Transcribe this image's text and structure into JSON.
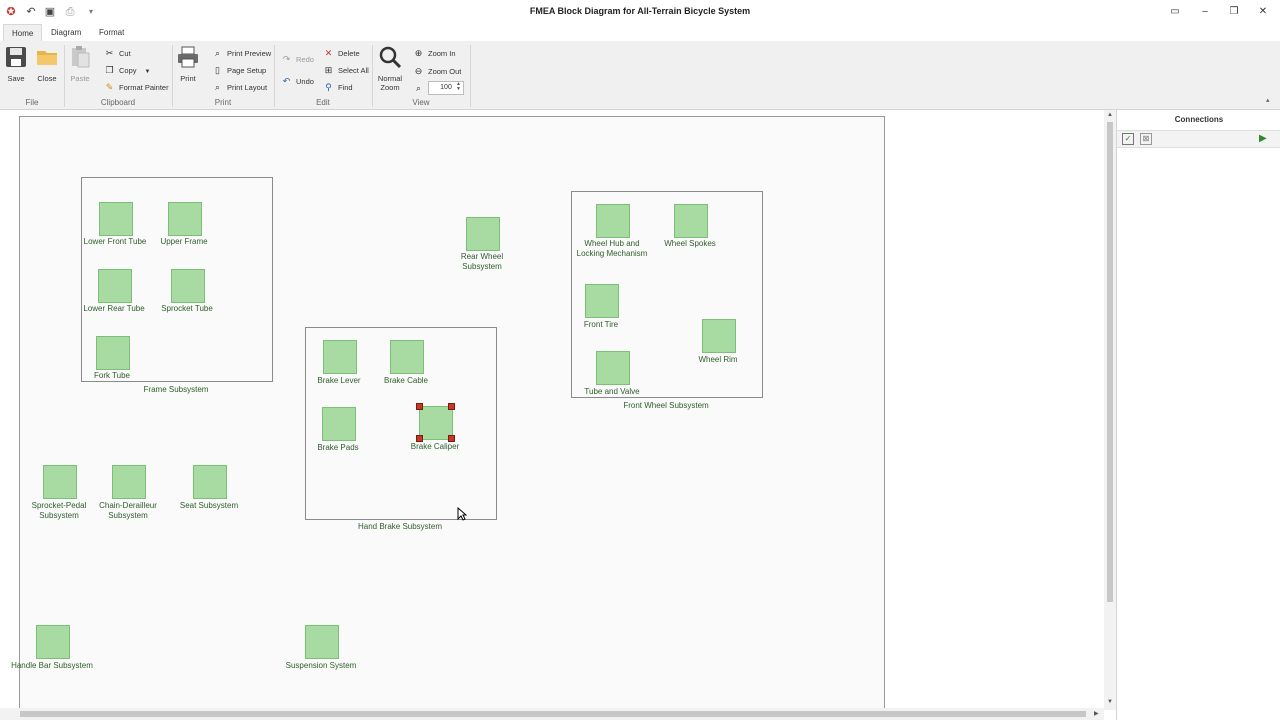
{
  "window": {
    "title": "FMEA Block Diagram for All-Terrain Bicycle System"
  },
  "tabs": [
    "Home",
    "Diagram",
    "Format"
  ],
  "ribbon": {
    "file": {
      "label": "File",
      "save": "Save",
      "close": "Close"
    },
    "clipboard": {
      "label": "Clipboard",
      "paste": "Paste",
      "cut": "Cut",
      "copy": "Copy",
      "format_painter": "Format Painter"
    },
    "print": {
      "label": "Print",
      "print": "Print",
      "print_preview": "Print Preview",
      "page_setup": "Page Setup",
      "print_layout": "Print Layout"
    },
    "edit": {
      "label": "Edit",
      "redo": "Redo",
      "undo": "Undo",
      "delete": "Delete",
      "select_all": "Select All",
      "find": "Find"
    },
    "view": {
      "label": "View",
      "normal_zoom": "Normal Zoom",
      "zoom_in": "Zoom In",
      "zoom_out": "Zoom Out",
      "zoom_value": "100"
    }
  },
  "diagram": {
    "frame_subsystem": {
      "label": "Frame Subsystem",
      "blocks": [
        "Lower Front Tube",
        "Upper Frame",
        "Lower Rear Tube",
        "Sprocket Tube",
        "Fork Tube"
      ]
    },
    "rear_wheel": "Rear Wheel Subsystem",
    "front_wheel_subsystem": {
      "label": "Front Wheel Subsystem",
      "blocks": [
        "Wheel Hub and Locking Mechanism",
        "Wheel Spokes",
        "Front Tire",
        "Wheel Rim",
        "Tube and Valve"
      ]
    },
    "hand_brake_subsystem": {
      "label": "Hand Brake Subsystem",
      "blocks": [
        "Brake Lever",
        "Brake Cable",
        "Brake Pads",
        "Brake Caliper"
      ]
    },
    "standalone": [
      "Sprocket-Pedal Subsystem",
      "Chain-Derailleur Subsystem",
      "Seat Subsystem",
      "Handle Bar Subsystem",
      "Suspension System"
    ],
    "selected": "Brake Caliper"
  },
  "panel": {
    "title": "Connections"
  },
  "colors": {
    "block_fill": "#a7dba1",
    "block_border": "#7cbf76",
    "label_text": "#2f5d2b",
    "selection_handle": "#c0392b"
  }
}
